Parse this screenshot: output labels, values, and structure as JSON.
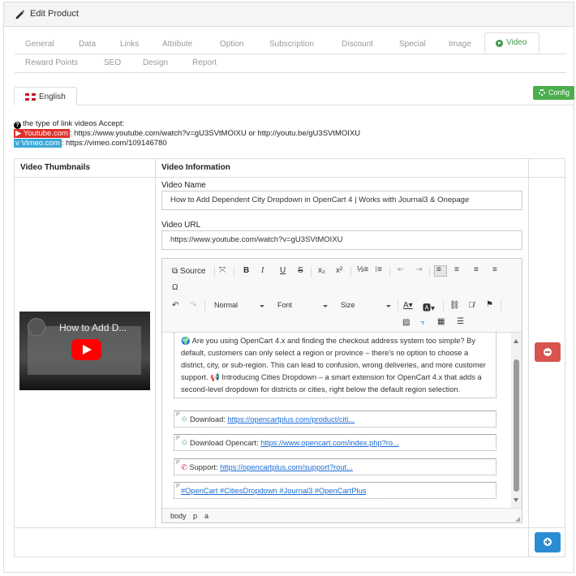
{
  "header": {
    "title": "Edit Product",
    "icon": "pencil-icon"
  },
  "tabs": {
    "row1": [
      "General",
      "Data",
      "Links",
      "Attribute",
      "Option",
      "Subscription",
      "Discount",
      "Special",
      "Image"
    ],
    "active": "Video",
    "row2": [
      "Reward Points",
      "SEO",
      "Design",
      "Report"
    ]
  },
  "language_tab": "English",
  "config_button": "Config",
  "help": {
    "intro": "the type of link videos Accept:",
    "youtube_label": "Youtube.com",
    "youtube_text": ": https://www.youtube.com/watch?v=gU3SVtMOIXU or http://youtu.be/gU3SVtMOIXU",
    "vimeo_label": "Vimeo.com",
    "vimeo_text": ": https://vimeo.com/109146780"
  },
  "table": {
    "col_thumbnails": "Video Thumbnails",
    "col_info": "Video Information"
  },
  "thumbnail": {
    "title": "How to Add D..."
  },
  "video": {
    "name_label": "Video Name",
    "name_value": "How to Add Dependent City Dropdown in OpenCart 4 | Works with Journal3 & Onepage",
    "url_label": "Video URL",
    "url_value": "https://www.youtube.com/watch?v=gU3SVtMOIXU"
  },
  "editor": {
    "toolbar": {
      "source": "Source",
      "format": "Normal",
      "font": "Font",
      "size": "Size"
    },
    "paragraphs": {
      "p1": "🌍 Are you using OpenCart 4.x and finding the checkout address system too simple? By default, customers can only select a region or province – there's no option to choose a district, city, or sub-region. This can lead to confusion, wrong deliveries, and more customer support. 📢 Introducing Cities Dropdown – a smart extension for OpenCart 4.x that adds a second-level dropdown for districts or cities, right below the default region selection.",
      "p2_label": "Download: ",
      "p2_link": "https://opencartplus.com/product/citi...",
      "p3_label": "Download Opencart: ",
      "p3_link": "https://www.opencart.com/index.php?ro...",
      "p4_label": "Support: ",
      "p4_link": "https://opencartplus.com/support?rout...",
      "p5_tags": "#OpenCart #CitiesDropdown #Journal3 #OpenCartPlus"
    },
    "status_path": [
      "body",
      "p",
      "a"
    ]
  },
  "colors": {
    "active_tab": "#3d9a4a",
    "config": "#4cae4c",
    "remove": "#d9534f",
    "add": "#2a8dd4",
    "youtube": "#e0302a",
    "vimeo": "#3aa8d8",
    "link": "#1a6bd6"
  }
}
